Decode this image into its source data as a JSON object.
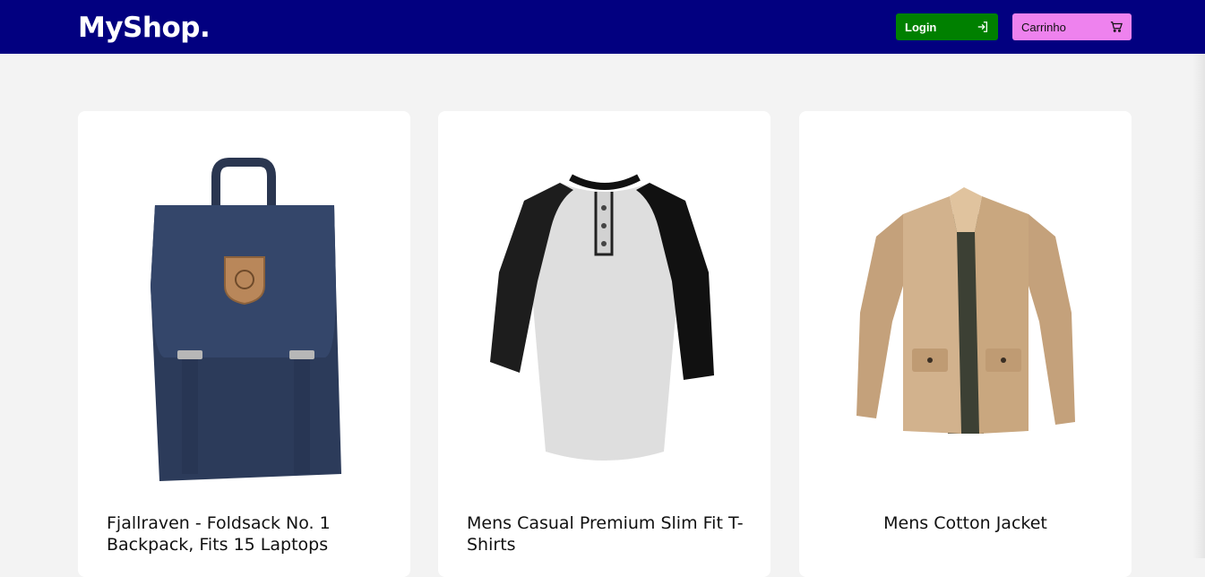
{
  "header": {
    "logo": "MyShop.",
    "login_label": "Login",
    "cart_label": "Carrinho",
    "login_icon": "login-icon",
    "cart_icon": "cart-icon"
  },
  "colors": {
    "header_bg": "#020080",
    "login_bg": "#008000",
    "cart_bg": "#ee82ee",
    "page_bg": "#f3f3f3"
  },
  "products": [
    {
      "title": "Fjallraven - Foldsack No. 1 Backpack, Fits 15 Laptops",
      "image": "backpack-image"
    },
    {
      "title": "Mens Casual Premium Slim Fit T-Shirts",
      "image": "tshirt-image"
    },
    {
      "title": "Mens Cotton Jacket",
      "image": "jacket-image"
    }
  ]
}
